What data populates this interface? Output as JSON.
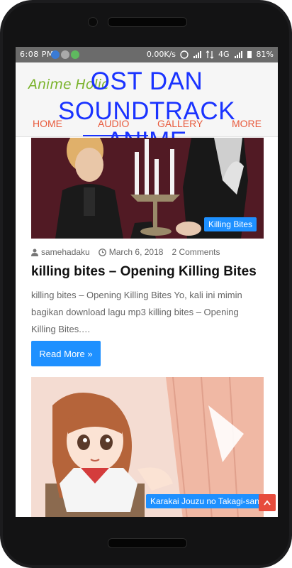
{
  "status_bar": {
    "time": "6:08 PM",
    "network_speed": "0.00K/s",
    "network_type": "4G",
    "battery": "81%"
  },
  "site": {
    "brand": "Anime Holic",
    "overlay_title": [
      "OST DAN SOUNDTRACK",
      "ANIME"
    ]
  },
  "nav": {
    "items": [
      "HOME",
      "AUDIO",
      "GALLERY",
      "MORE"
    ],
    "active_index": 1
  },
  "post1": {
    "category": "Killing Bites",
    "author": "samehadaku",
    "date": "March 6, 2018",
    "comments": "2 Comments",
    "title": "killing bites – Opening Killing Bites",
    "excerpt": "killing bites – Opening Killing Bites Yo, kali ini mimin bagikan download lagu mp3 killing bites – Opening Killing Bites.…",
    "read_more": "Read More »"
  },
  "post2": {
    "category": "Karakai Jouzu no Takagi-san"
  },
  "colors": {
    "accent": "#1e90ff",
    "nav_text": "#e85a3c",
    "overlay": "#1a33ff",
    "scroll_top": "#e74c3c"
  },
  "icons": {
    "author": "user-icon",
    "date": "clock-icon",
    "scroll_top": "chevron-up-icon"
  }
}
